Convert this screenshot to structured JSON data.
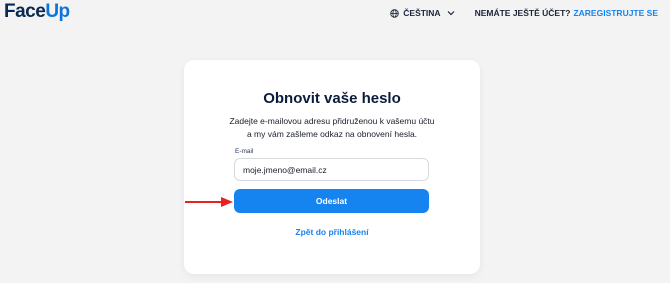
{
  "header": {
    "logo_part1": "Face",
    "logo_part2": "Up",
    "language": "ČEŠTINA",
    "no_account_text": "NEMÁTE JEŠTĚ ÚČET?",
    "register_link": "ZAREGISTRUJTE SE",
    "icons": {
      "language": "globe-icon",
      "dropdown": "chevron-down-icon"
    }
  },
  "form": {
    "title": "Obnovit vaše heslo",
    "description": "Zadejte e-mailovou adresu přidruženou k vašemu účtu a my vám zašleme odkaz na obnovení hesla.",
    "email_label": "E-mail",
    "email_value": "moje.jmeno@email.cz",
    "submit_label": "Odeslat",
    "back_link": "Zpět do přihlášení"
  },
  "annotation": {
    "icon": "arrow-right-icon",
    "color": "#e8231f"
  },
  "colors": {
    "accent": "#1684f0",
    "logo": "#062a52",
    "background": "#f3f3f4"
  }
}
